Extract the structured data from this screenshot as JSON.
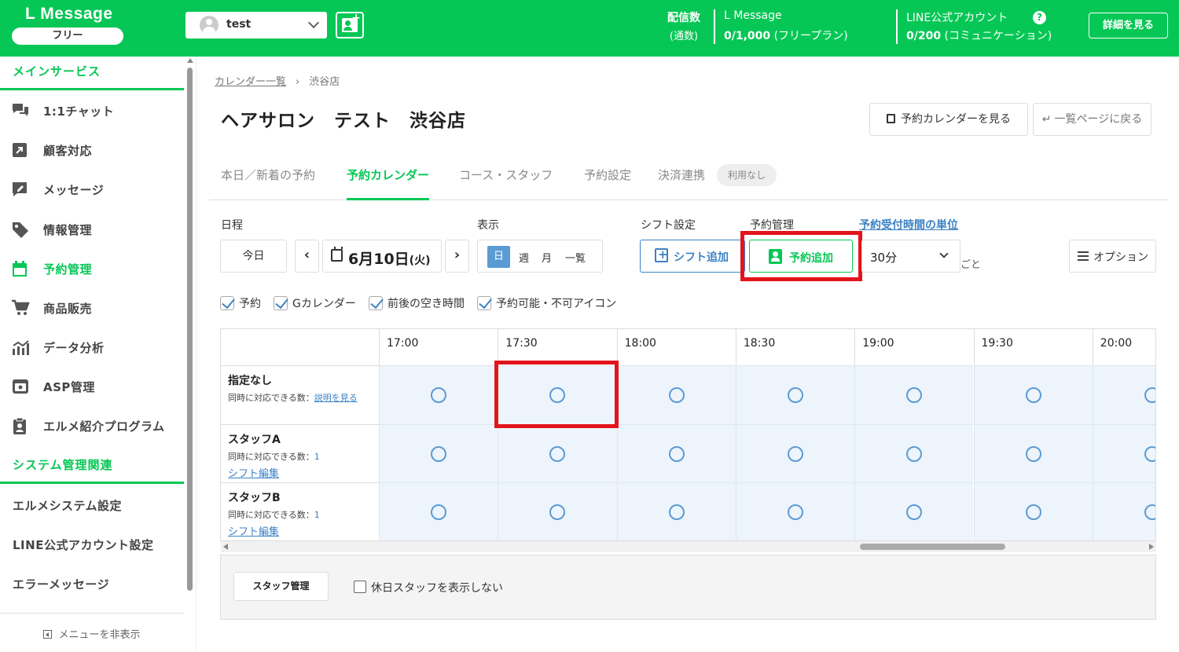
{
  "header": {
    "logo": "L Message",
    "plan_badge": "フリー",
    "account_name": "test",
    "delivery_label": "配信数",
    "delivery_sub": "(通数)",
    "lmessage_name": "L Message",
    "lmessage_count": "0/1,000",
    "lmessage_plan": "(フリープラン)",
    "line_name": "LINE公式アカウント",
    "line_count": "0/200",
    "line_plan": "(コミュニケーション)",
    "help_glyph": "?",
    "detail_button": "詳細を見る"
  },
  "sidebar": {
    "section_main": "メインサービス",
    "items": [
      {
        "label": "1:1チャット",
        "icon": "chat-icon"
      },
      {
        "label": "顧客対応",
        "icon": "arrow-box-icon"
      },
      {
        "label": "メッセージ",
        "icon": "message-edit-icon"
      },
      {
        "label": "情報管理",
        "icon": "tag-icon"
      },
      {
        "label": "予約管理",
        "icon": "calendar-icon"
      },
      {
        "label": "商品販売",
        "icon": "cart-icon"
      },
      {
        "label": "データ分析",
        "icon": "chart-icon"
      },
      {
        "label": "ASP管理",
        "icon": "asp-icon"
      },
      {
        "label": "エルメ紹介プログラム",
        "icon": "clipboard-icon"
      }
    ],
    "section_system": "システム管理関連",
    "system_items": [
      "エルメシステム設定",
      "LINE公式アカウント設定",
      "エラーメッセージ"
    ],
    "hide_menu": "メニューを非表示"
  },
  "breadcrumb": {
    "parent": "カレンダー一覧",
    "current": "渋谷店"
  },
  "page_title": "ヘアサロン　テスト　渋谷店",
  "view_calendar_button": "予約カレンダーを見る",
  "back_button": "一覧ページに戻る",
  "tabs": [
    "本日／新着の予約",
    "予約カレンダー",
    "コース・スタッフ",
    "予約設定",
    "決済連携"
  ],
  "tab_badge": "利用なし",
  "controls": {
    "schedule_label": "日程",
    "today_button": "今日",
    "prev": "‹",
    "next": "›",
    "date_main": "6月10日",
    "date_weekday": "(火)",
    "display_label": "表示",
    "view_day": "日",
    "view_week": "週",
    "view_month": "月",
    "view_list": "一覧",
    "shift_label": "シフト設定",
    "shift_button": "シフト追加",
    "reservation_label": "予約管理",
    "add_reservation_button": "予約追加",
    "unit_link": "予約受付時間の単位",
    "unit_value": "30分",
    "unit_suffix": "ごと",
    "option_button": "オプション"
  },
  "filters": [
    "予約",
    "Gカレンダー",
    "前後の空き時間",
    "予約可能・不可アイコン"
  ],
  "grid": {
    "times": [
      "17:00",
      "17:30",
      "18:00",
      "18:30",
      "19:00",
      "19:30",
      "20:00"
    ],
    "rows": [
      {
        "name": "指定なし",
        "capacity_label": "同時に対応できる数：",
        "capacity_link": "説明を見る",
        "edit": ""
      },
      {
        "name": "スタッフA",
        "capacity_label": "同時に対応できる数：",
        "capacity_link": "1",
        "edit": "シフト編集"
      },
      {
        "name": "スタッフB",
        "capacity_label": "同時に対応できる数：",
        "capacity_link": "1",
        "edit": "シフト編集"
      }
    ],
    "slot_available": true
  },
  "footer": {
    "staff_button": "スタッフ管理",
    "hide_holiday_label": "休日スタッフを表示しない"
  },
  "colors": {
    "brand": "#06c755",
    "link": "#3b82c4",
    "highlight": "#e3141b",
    "cell_bg": "#eef4fb"
  }
}
